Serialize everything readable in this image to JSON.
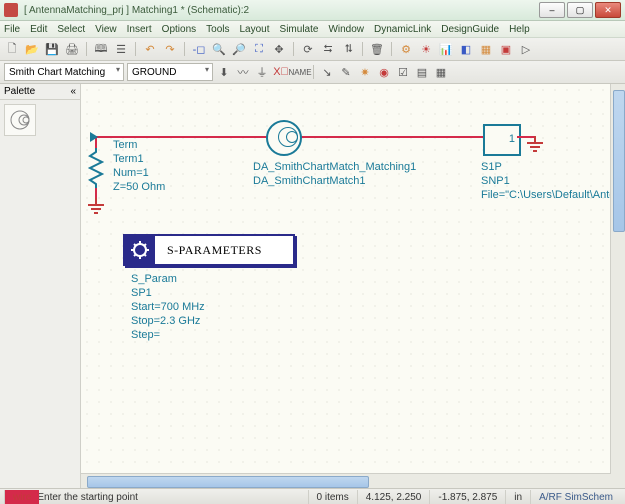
{
  "window": {
    "title": "[ AntennaMatching_prj ] Matching1 * (Schematic):2",
    "buttons": {
      "min": "–",
      "max": "▢",
      "close": "✕"
    }
  },
  "menu": {
    "items": [
      "File",
      "Edit",
      "Select",
      "View",
      "Insert",
      "Options",
      "Tools",
      "Layout",
      "Simulate",
      "Window",
      "DynamicLink",
      "DesignGuide",
      "Help"
    ]
  },
  "toolbar2": {
    "combo1": "Smith Chart Matching",
    "combo2": "GROUND"
  },
  "palette": {
    "title": "Palette",
    "expand": "«"
  },
  "schematic": {
    "term": {
      "label": "Term",
      "name": "Term1",
      "num": "Num=1",
      "z": "Z=50 Ohm"
    },
    "smith": {
      "name": "DA_SmithChartMatch_Matching1",
      "inst": "DA_SmithChartMatch1"
    },
    "snp": {
      "name": "S1P",
      "inst": "SNP1",
      "file": "File=\"C:\\Users\\Default\\Ante"
    },
    "sp": {
      "box_label": "S-PARAMETERS",
      "name": "S_Param",
      "inst": "SP1",
      "start": "Start=700 MHz",
      "stop": "Stop=2.3 GHz",
      "step": "Step="
    }
  },
  "status": {
    "hint": "Select: Enter the starting point",
    "items": "0 items",
    "mode": "wire",
    "coord1": "4.125, 2.250",
    "coord2": "-1.875, 2.875",
    "units": "in",
    "space": "A/RF  SimSchem"
  }
}
